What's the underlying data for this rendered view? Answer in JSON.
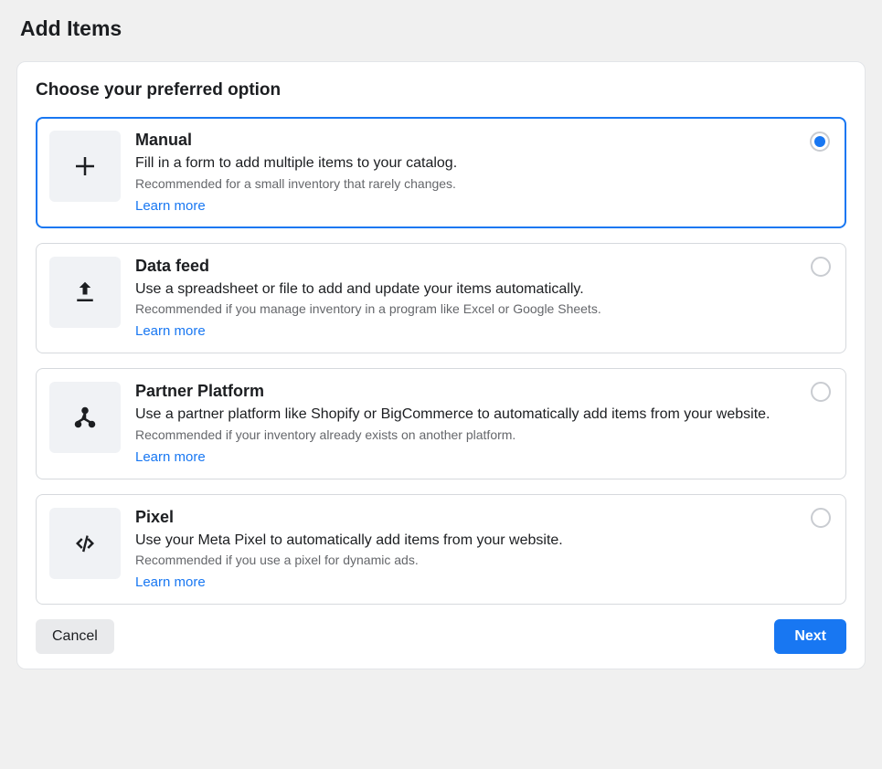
{
  "page_title": "Add Items",
  "section_title": "Choose your preferred option",
  "options": [
    {
      "title": "Manual",
      "description": "Fill in a form to add multiple items to your catalog.",
      "recommendation": "Recommended for a small inventory that rarely changes.",
      "learn_more_label": "Learn more",
      "selected": true,
      "icon": "plus"
    },
    {
      "title": "Data feed",
      "description": "Use a spreadsheet or file to add and update your items automatically.",
      "recommendation": "Recommended if you manage inventory in a program like Excel or Google Sheets.",
      "learn_more_label": "Learn more",
      "selected": false,
      "icon": "upload"
    },
    {
      "title": "Partner Platform",
      "description": "Use a partner platform like Shopify or BigCommerce to automatically add items from your website.",
      "recommendation": "Recommended if your inventory already exists on another platform.",
      "learn_more_label": "Learn more",
      "selected": false,
      "icon": "network"
    },
    {
      "title": "Pixel",
      "description": "Use your Meta Pixel to automatically add items from your website.",
      "recommendation": "Recommended if you use a pixel for dynamic ads.",
      "learn_more_label": "Learn more",
      "selected": false,
      "icon": "code"
    }
  ],
  "buttons": {
    "cancel": "Cancel",
    "next": "Next"
  }
}
